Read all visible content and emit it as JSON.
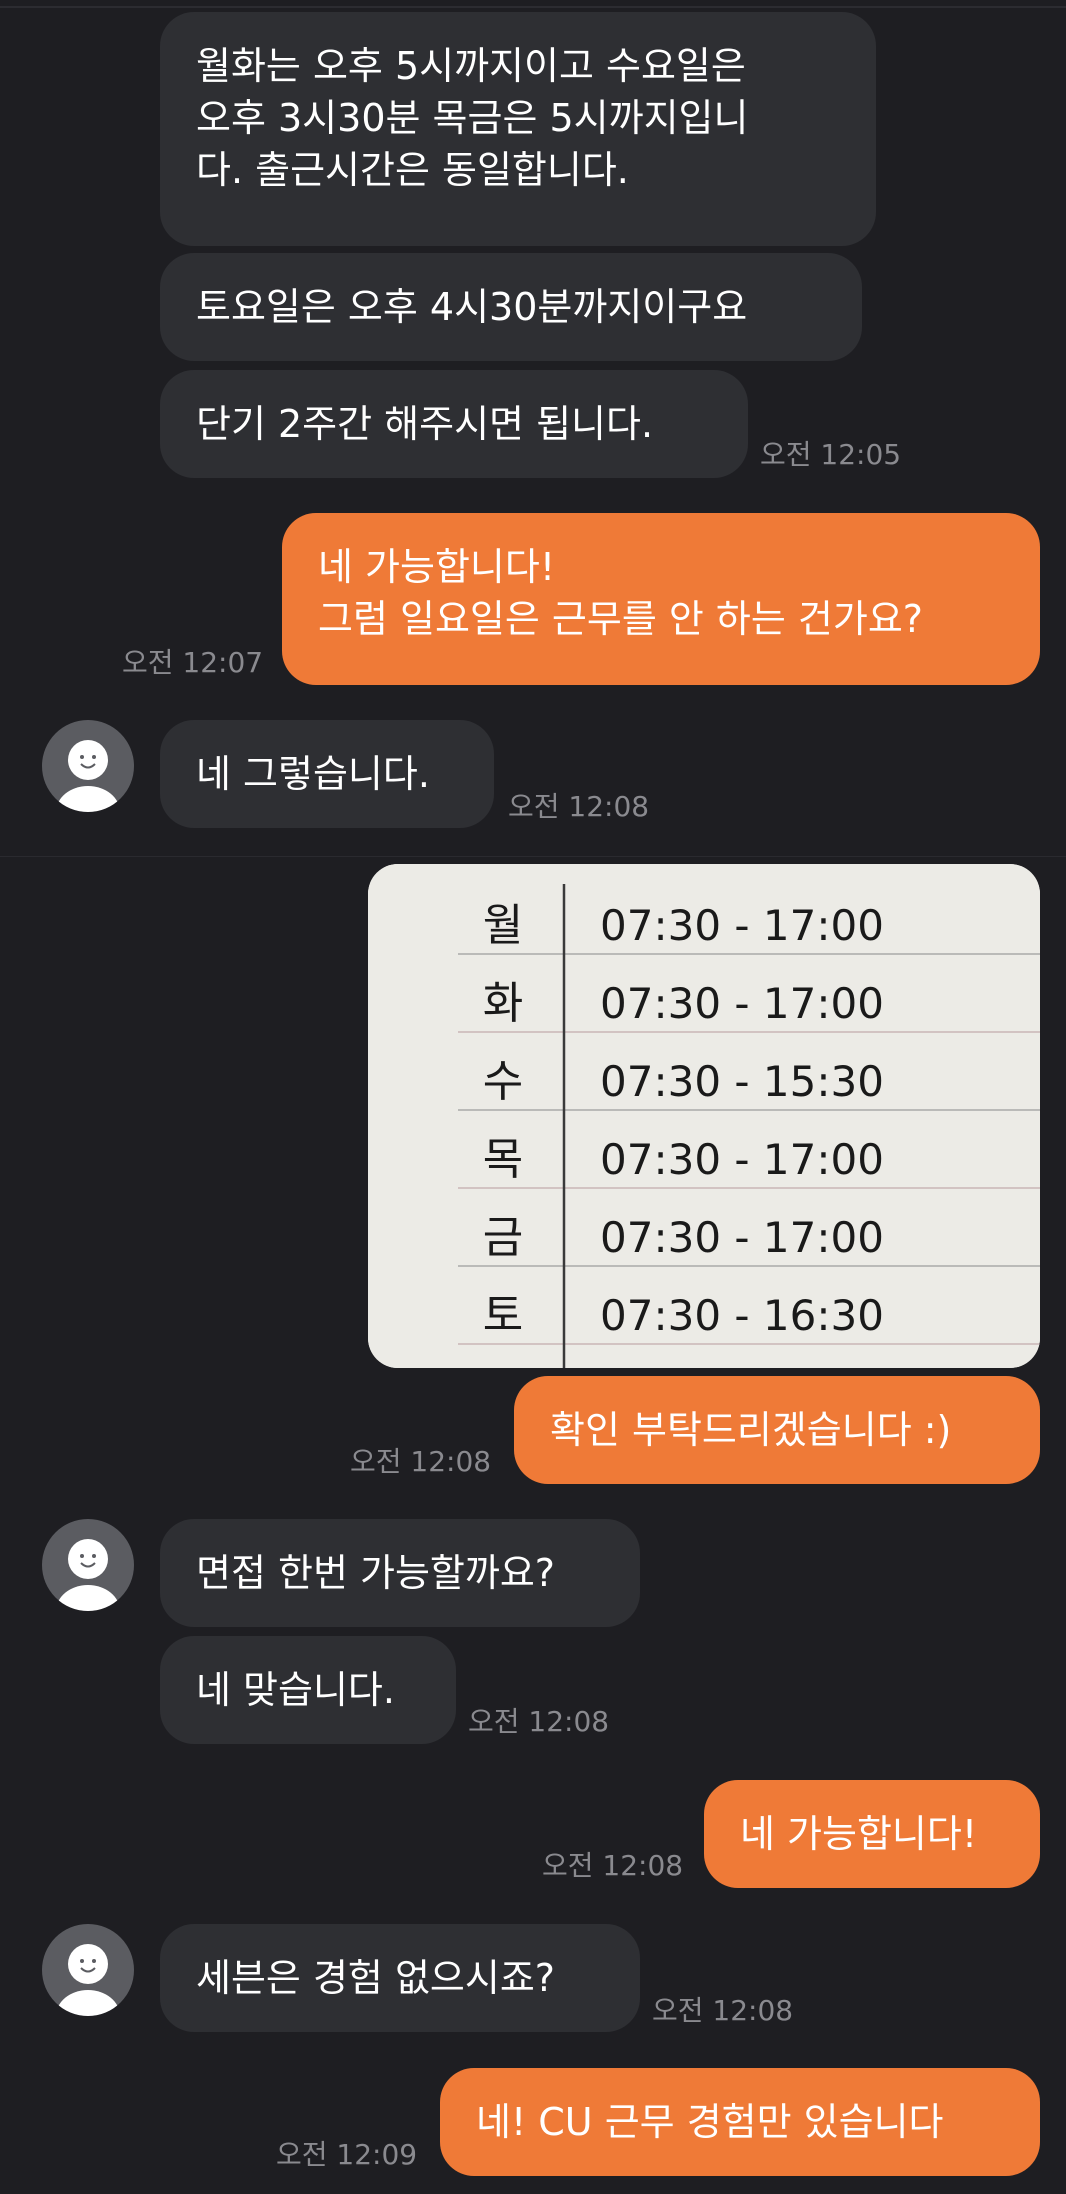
{
  "messages": [
    {
      "id": "m1",
      "text": "월화는 오후 5시까지이고 수요일은\n오후 3시30분 목금은 5시까지입니\n다. 출근시간은 동일합니다."
    },
    {
      "id": "m2",
      "text": "토요일은 오후 4시30분까지이구요"
    },
    {
      "id": "m3",
      "text": "단기 2주간 해주시면 됩니다.",
      "time": "오전 12:05"
    },
    {
      "id": "m4",
      "text": "네 가능합니다!\n그럼 일요일은 근무를 안 하는 건가요?",
      "time": "오전 12:07"
    },
    {
      "id": "m5",
      "text": "네 그렇습니다.",
      "time": "오전 12:08"
    },
    {
      "id": "m6",
      "text": "확인 부탁드리겠습니다 :)",
      "time": "오전 12:08"
    },
    {
      "id": "m7",
      "text": "면접 한번 가능할까요?"
    },
    {
      "id": "m8",
      "text": "네 맞습니다.",
      "time": "오전 12:08"
    },
    {
      "id": "m9",
      "text": "네 가능합니다!",
      "time": "오전 12:08"
    },
    {
      "id": "m10",
      "text": "세븐은 경험 없으시죠?",
      "time": "오전 12:08"
    },
    {
      "id": "m11",
      "text": "네! CU 근무 경험만 있습니다",
      "time": "오전 12:09"
    }
  ],
  "schedule_photo": {
    "rows": [
      {
        "day": "월",
        "hours": "07:30 - 17:00"
      },
      {
        "day": "화",
        "hours": "07:30 - 17:00"
      },
      {
        "day": "수",
        "hours": "07:30 - 15:30"
      },
      {
        "day": "목",
        "hours": "07:30 - 17:00"
      },
      {
        "day": "금",
        "hours": "07:30 - 17:00"
      },
      {
        "day": "토",
        "hours": "07:30 - 16:30"
      }
    ]
  },
  "colors": {
    "background": "#1e1e22",
    "incoming_bubble": "#2e2f33",
    "outgoing_bubble": "#ef7a37",
    "timestamp": "#8a8a8f"
  },
  "icons": {
    "avatar": "default-profile-icon"
  }
}
